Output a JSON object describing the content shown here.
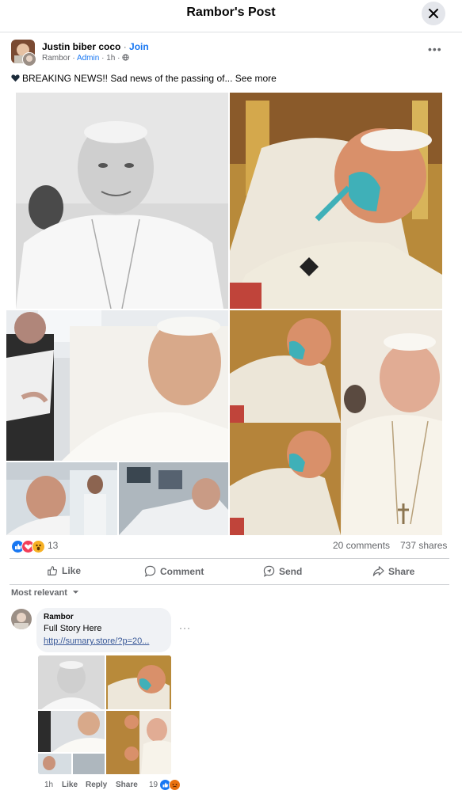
{
  "header": {
    "title": "Rambor's Post"
  },
  "post": {
    "group_name": "Justin biber coco",
    "separator": "·",
    "join_label": "Join",
    "author": "Rambor",
    "role_badge": "Admin",
    "time": "1h",
    "text": "BREAKING NEWS!! Sad news of the passing of...",
    "see_more": "See more"
  },
  "stats": {
    "reaction_count": "13",
    "comments": "20 comments",
    "shares": "737 shares"
  },
  "actions": {
    "like": "Like",
    "comment": "Comment",
    "send": "Send",
    "share": "Share"
  },
  "sort": {
    "label": "Most relevant"
  },
  "comment": {
    "author": "Rambor",
    "text": "Full Story Here",
    "link": "http://sumary.store/?p=20...",
    "time": "1h",
    "like": "Like",
    "reply": "Reply",
    "share": "Share",
    "reaction_count": "19"
  },
  "colors": {
    "accent": "#1877f2",
    "link": "#385898",
    "muted": "#65676b",
    "divider": "#ced0d4",
    "like_blue": "#1877f2",
    "love_red": "#f33e58",
    "wow_yellow": "#f7b125"
  },
  "icons": [
    "close-icon",
    "globe-icon",
    "black-heart-icon",
    "like-icon",
    "comment-icon",
    "send-icon",
    "share-icon",
    "chevron-down-icon",
    "more-icon"
  ]
}
